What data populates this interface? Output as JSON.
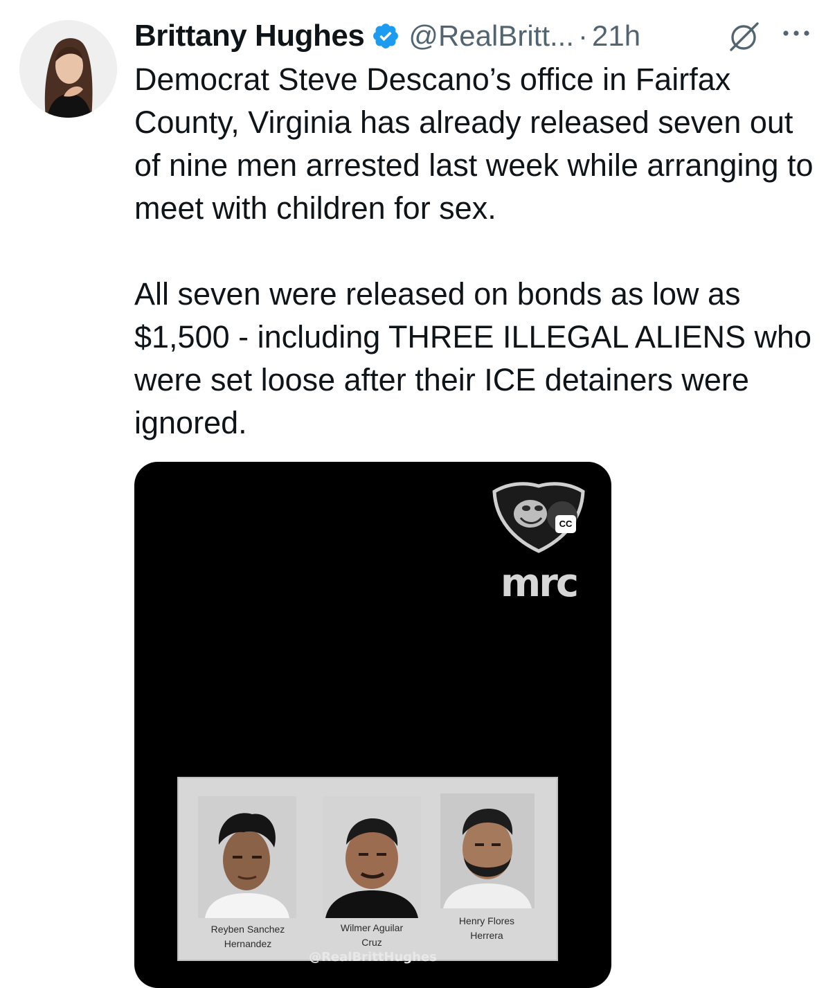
{
  "tweet": {
    "author_name": "Brittany Hughes",
    "handle": "@RealBritt...",
    "separator": "·",
    "timestamp": "21h",
    "paragraphs": [
      "Democrat Steve Descano’s office in Fairfax County, Virginia has already released seven out of nine men arrested last week while arranging to meet with children for sex.",
      "All seven were released on bonds as low as $1,500 - including THREE ILLEGAL ALIENS who were set loose after their ICE detainers were ignored."
    ]
  },
  "media": {
    "logo_text": "mrc",
    "cc_label": "CC",
    "captions": [
      "Reyben Sanchez\nHernandez",
      "Wilmer Aguilar\nCruz",
      "Henry Flores\nHerrera"
    ],
    "watermark": "@RealBrittHughes"
  },
  "icons": {
    "verified": "verified-badge-icon",
    "grok": "grok-icon",
    "more": "more-icon"
  },
  "colors": {
    "verified_blue": "#1d9bf0",
    "secondary_text": "#536471",
    "primary_text": "#0f1419"
  }
}
